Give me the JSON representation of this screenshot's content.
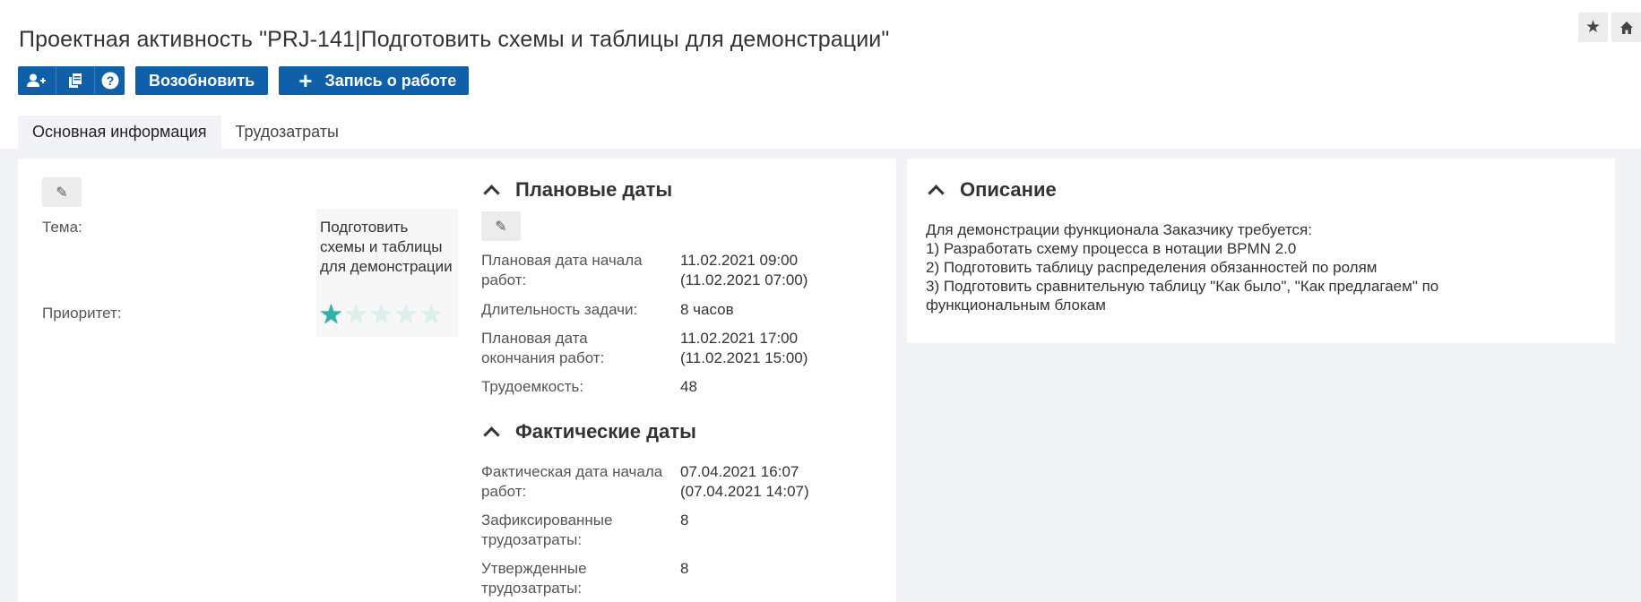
{
  "header": {
    "title": "Проектная активность \"PRJ-141|Подготовить схемы и таблицы для демонстрации\"",
    "icons": [
      "star-icon",
      "home-icon"
    ]
  },
  "toolbar": {
    "icon_buttons": [
      "add-user-icon",
      "copy-icon",
      "help-icon"
    ],
    "resume_label": "Возобновить",
    "work_record_label": "Запись о работе"
  },
  "tabs": [
    {
      "label": "Основная информация",
      "active": true
    },
    {
      "label": "Трудозатраты",
      "active": false
    }
  ],
  "main": {
    "topic_label": "Тема:",
    "topic_value": "Подготовить схемы и таблицы для демонстрации",
    "priority_label": "Приоритет:",
    "priority_stars": 1,
    "priority_max": 5
  },
  "planned": {
    "title": "Плановые даты",
    "rows": [
      {
        "label": "Плановая дата начала работ:",
        "value": "11.02.2021 09:00\n(11.02.2021 07:00)"
      },
      {
        "label": "Длительность задачи:",
        "value": "8 часов"
      },
      {
        "label": "Плановая дата окончания работ:",
        "value": "11.02.2021 17:00\n(11.02.2021 15:00)"
      },
      {
        "label": "Трудоемкость:",
        "value": "48"
      }
    ]
  },
  "actual": {
    "title": "Фактические даты",
    "rows": [
      {
        "label": "Фактическая дата начала работ:",
        "value": "07.04.2021 16:07\n(07.04.2021 14:07)"
      },
      {
        "label": "Зафиксированные трудозатраты:",
        "value": "8"
      },
      {
        "label": "Утвержденные трудозатраты:",
        "value": "8"
      }
    ]
  },
  "description": {
    "title": "Описание",
    "text": "Для демонстрации функционала Заказчику требуется:\n1) Разработать схему процесса в нотации BPMN 2.0\n2) Подготовить таблицу распределения обязанностей по ролям\n3) Подготовить сравнительную таблицу \"Как было\", \"Как предлагаем\" по функциональным блокам"
  },
  "colors": {
    "primary": "#0f5fa9",
    "background": "#f1f3f7",
    "star_active": "#2fb2a8"
  }
}
